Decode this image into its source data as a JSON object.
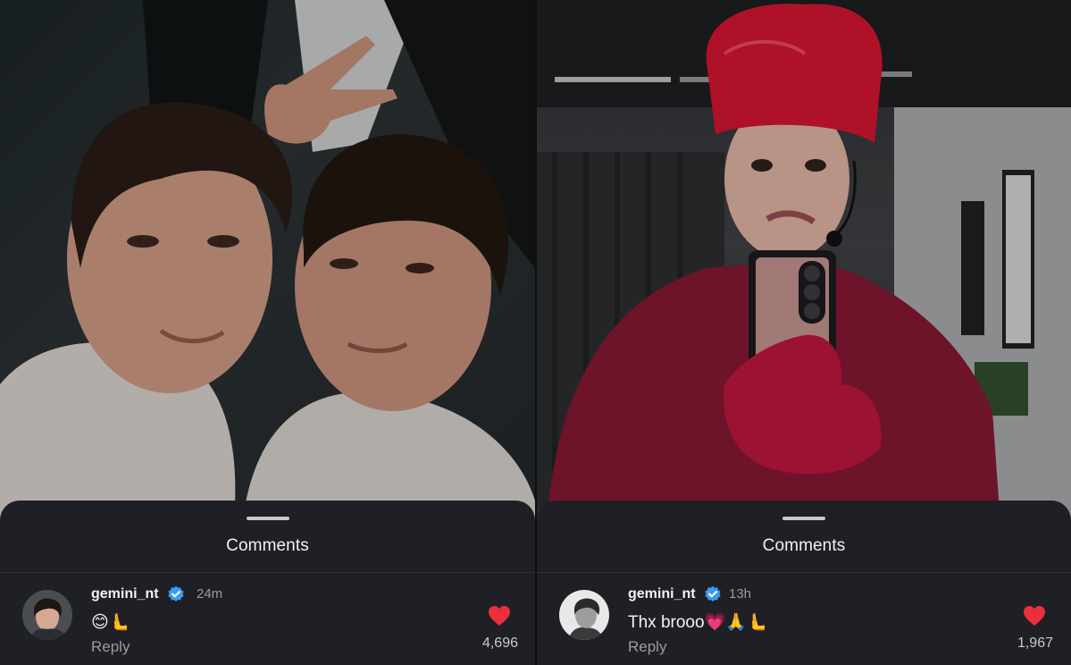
{
  "panels": [
    {
      "sheet_title": "Comments",
      "comment": {
        "username": "gemini_nt",
        "time": "24m",
        "text": "😊🫷",
        "reply_label": "Reply",
        "like_count": "4,696"
      }
    },
    {
      "sheet_title": "Comments",
      "comment": {
        "username": "gemini_nt",
        "time": "13h",
        "text": "Thx brooo💗🙏🫷",
        "reply_label": "Reply",
        "like_count": "1,967"
      }
    }
  ],
  "icons": {
    "verified": "verified-badge-icon",
    "like": "heart-icon"
  },
  "colors": {
    "sheet_background": "#1e2025",
    "heart": "#ec2f3b",
    "verified": "#3b9bf0",
    "secondary_text": "#9a9ca3"
  }
}
